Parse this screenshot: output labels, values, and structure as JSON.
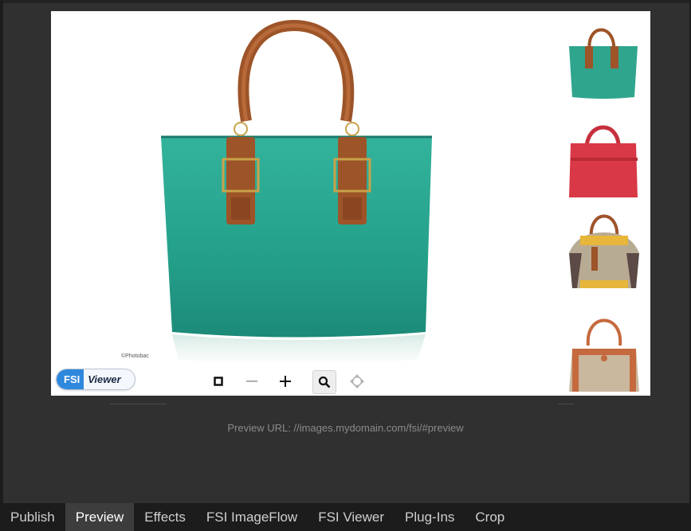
{
  "viewer": {
    "copyright": "©Photobac",
    "logo": {
      "part1": "FSI",
      "part2": "Viewer"
    },
    "toolbar": [
      "stop-icon",
      "zoom-out-icon",
      "zoom-in-icon",
      "magnifier-icon",
      "pan-icon"
    ],
    "thumbnails": [
      {
        "name": "teal-tote",
        "color": "#2fa58e"
      },
      {
        "name": "red-tote",
        "color": "#d93846"
      },
      {
        "name": "beige-bag",
        "color": "#b8ab94"
      },
      {
        "name": "canvas-bag",
        "color": "#c9b79e"
      }
    ]
  },
  "preview": {
    "url_text": "Preview URL:  //images.mydomain.com/fsi/#preview"
  },
  "tabs": [
    {
      "label": "Publish",
      "active": false
    },
    {
      "label": "Preview",
      "active": true
    },
    {
      "label": "Effects",
      "active": false
    },
    {
      "label": "FSI ImageFlow",
      "active": false
    },
    {
      "label": "FSI Viewer",
      "active": false
    },
    {
      "label": "Plug-Ins",
      "active": false
    },
    {
      "label": "Crop",
      "active": false
    }
  ],
  "colors": {
    "teal": "#2fa58e",
    "leather": "#a0532a",
    "background": "#303030",
    "tabbar": "#1c1c1c"
  }
}
